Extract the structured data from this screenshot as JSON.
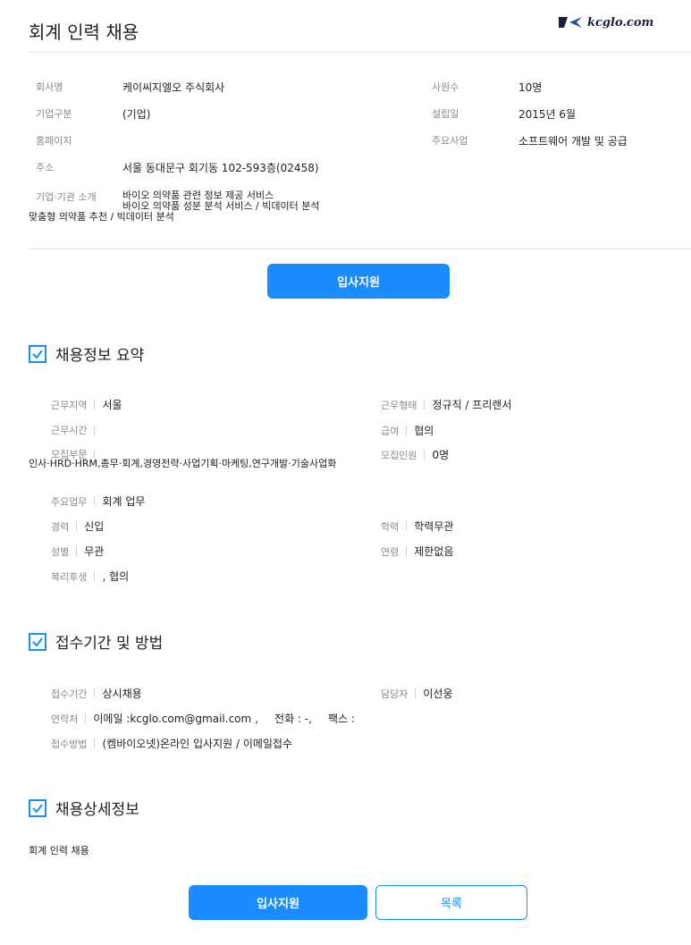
{
  "header": {
    "title": "회계 인력 채용",
    "logo_text": "kcglo.com"
  },
  "company": {
    "name_label": "회사명",
    "name": "케이씨지엘오 주식회사",
    "type_label": "기업구분",
    "type": "(기업)",
    "homepage_label": "홈페이지",
    "homepage": "",
    "address_label": "주소",
    "address": "서울 동대문구 회기동 102-593층(02458)",
    "intro_label": "기업·기관 소개",
    "intro_line1": "바이오 의약품 관련 정보 제공 서비스",
    "intro_line2": "바이오 의약품 성분 분석 서비스 / 빅데이터 분석",
    "intro_line3": "맞춤형 의약품 추천 / 빅데이터 분석",
    "employees_label": "사원수",
    "employees": "10명",
    "founded_label": "설립일",
    "founded": "2015년 6월",
    "business_label": "주요사업",
    "business": "소프트웨어 개발 및 공급"
  },
  "apply_button": "입사지원",
  "summary": {
    "title": "채용정보 요약",
    "region_label": "근무지역",
    "region": "서울",
    "hours_label": "근무시간",
    "hours": "",
    "dept_label": "모집부문",
    "dept": "인사·HRD·HRM,총무·회계,경영전략·사업기획·마케팅,연구개발·기술사업화",
    "duty_label": "주요업무",
    "duty": "회계 업무",
    "career_label": "경력",
    "career": "신입",
    "gender_label": "성별",
    "gender": "무관",
    "welfare_label": "복리후생",
    "welfare": ", 협의",
    "worktype_label": "근무형태",
    "worktype": "정규직 / 프리랜서",
    "salary_label": "급여",
    "salary": "협의",
    "headcount_label": "모집인원",
    "headcount": "0명",
    "education_label": "학력",
    "education": "학력무관",
    "age_label": "연령",
    "age": "제한없음"
  },
  "reception": {
    "title": "접수기간 및 방법",
    "period_label": "접수기간",
    "period": "상시채용",
    "contact_label": "연락처",
    "email_prefix": "이메일 : ",
    "email": "kcglo.com@gmail.com",
    "phone": "전화 : -,",
    "fax": "팩스 :",
    "method_label": "접수방법",
    "method": "(켐바이오넷)온라인 입사지원 / 이메일접수",
    "manager_label": "담당자",
    "manager": "이선웅"
  },
  "detail": {
    "title": "채용상세정보",
    "body": "회계 인력 채용"
  },
  "footer": {
    "apply_label": "입사지원",
    "list_label": "목록"
  },
  "colors": {
    "accent": "#1a8cff",
    "logo": "#1a1f3a"
  }
}
